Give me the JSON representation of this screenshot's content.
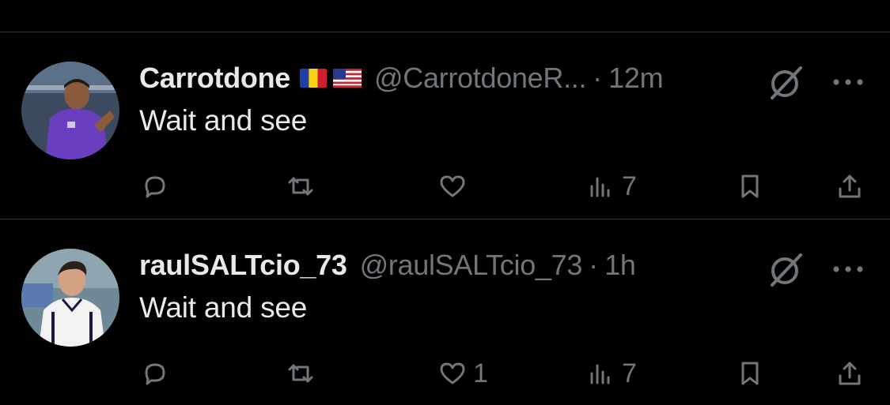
{
  "tweets": [
    {
      "display_name": "Carrotdone",
      "flags": [
        "romania-flag-icon",
        "usa-flag-icon"
      ],
      "handle": "@CarrotdoneR...",
      "separator": "·",
      "time": "12m",
      "text": "Wait and see",
      "reply_count": "",
      "retweet_count": "",
      "like_count": "",
      "view_count": "7",
      "avatar_bg": "#3b4a5e",
      "jersey_color": "#6a3fbf"
    },
    {
      "display_name": "raulSALTcio_73",
      "flags": [],
      "handle": "@raulSALTcio_73",
      "separator": "·",
      "time": "1h",
      "text": "Wait and see",
      "reply_count": "",
      "retweet_count": "",
      "like_count": "1",
      "view_count": "7",
      "avatar_bg": "#6f8a96",
      "jersey_color": "#f2f2f2"
    }
  ],
  "colors": {
    "background": "#000000",
    "primary_text": "#e7e9ea",
    "secondary_text": "#71767b",
    "divider": "#2f3336"
  }
}
